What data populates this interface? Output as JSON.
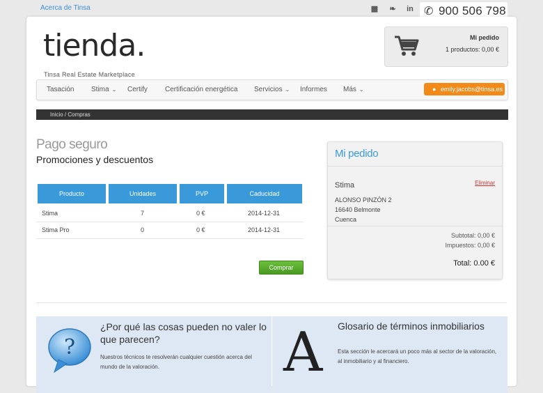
{
  "topbar": {
    "about_link": "Acerca de Tinsa",
    "social": [
      {
        "icon": "chat-icon",
        "glyph": "■"
      },
      {
        "icon": "twitter-icon",
        "glyph": "❧"
      },
      {
        "icon": "linkedin-icon",
        "glyph": "in"
      }
    ],
    "phone": "900 506 798"
  },
  "logo": {
    "word": "tienda.",
    "tagline": "Tinsa Real Estate Marketplace"
  },
  "cart": {
    "title": "Mi pedido",
    "summary": "1 productos: 0,00 €"
  },
  "nav": {
    "items": [
      {
        "label": "Tasación",
        "dropdown": false
      },
      {
        "label": "Stima",
        "dropdown": true
      },
      {
        "label": "Certify",
        "dropdown": false
      },
      {
        "label": "Certificación energética",
        "dropdown": false
      },
      {
        "label": "Servicios",
        "dropdown": true
      },
      {
        "label": "Informes",
        "dropdown": false
      },
      {
        "label": "Más",
        "dropdown": true
      }
    ],
    "user_label": "emily.jacobs@tinsa.es"
  },
  "breadcrumb": "Inicio / Compras",
  "main": {
    "title": "Pago seguro",
    "subtitle": "Promociones y descuentos",
    "table": {
      "headers": [
        "Producto",
        "Unidades",
        "PVP",
        "Caducidad"
      ],
      "rows": [
        [
          "Stima",
          "7",
          "0 €",
          "2014-12-31"
        ],
        [
          "Stima Pro",
          "0",
          "0 €",
          "2014-12-31"
        ]
      ]
    },
    "buy_button": "Comprar"
  },
  "order": {
    "title": "Mi pedido",
    "product": "Stima",
    "delete": "Eliminar",
    "address": [
      "ALONSO PINZÓN 2",
      "16640 Belmonte",
      "Cuenca"
    ],
    "subtotal": "Subtotal: 0,00 €",
    "taxes": "Impuestos: 0,00 €",
    "total": "Total: 0.00 €"
  },
  "info": {
    "left": {
      "title": "¿Por qué las cosas pueden no valer lo que parecen?",
      "text": "Nuestros técnicos te resolverán cualquier cuestión acerca del mundo de la valoración."
    },
    "right": {
      "title": "Glosario de términos inmobiliarios",
      "text": "Esta sección le acercará un poco más al sector de la valoración, al inmobiliario y al financiero.",
      "glyph": "A"
    }
  },
  "colors": {
    "accent_blue": "#3a9ad9",
    "orange": "#f28a1a",
    "green": "#5aab2e"
  }
}
